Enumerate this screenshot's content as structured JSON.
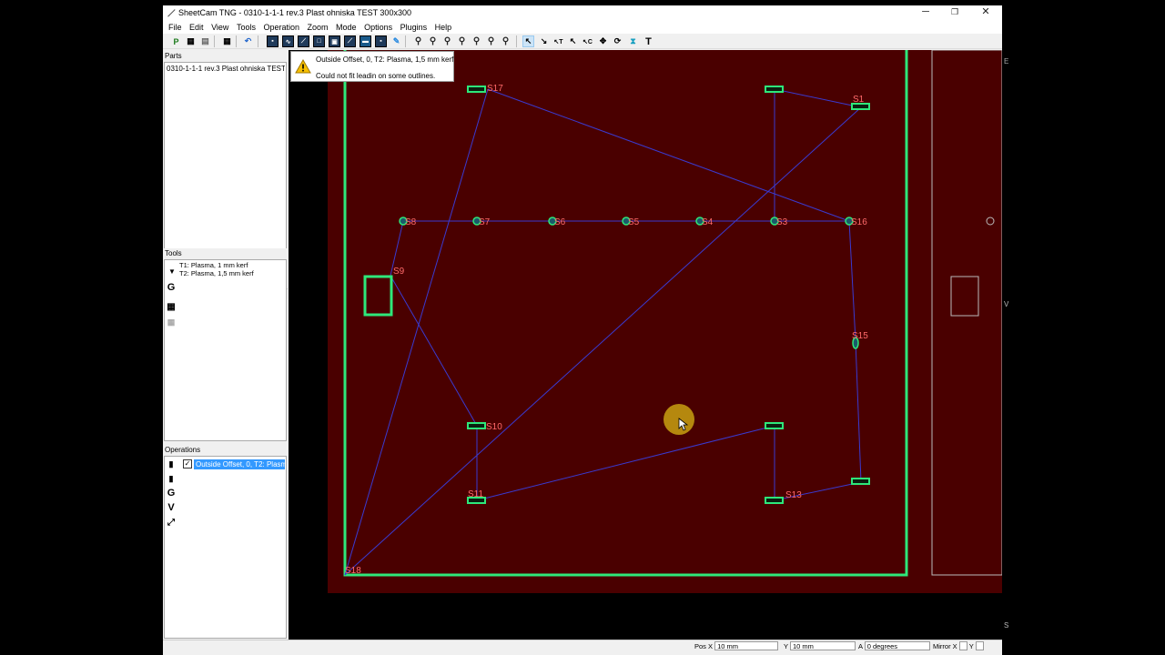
{
  "window": {
    "title": "SheetCam TNG - 0310-1-1-1 rev.3 Plast ohniska TEST 300x300",
    "minimize": "─",
    "maximize": "❐",
    "close": "✕"
  },
  "menu": [
    "File",
    "Edit",
    "View",
    "Tools",
    "Operation",
    "Zoom",
    "Mode",
    "Options",
    "Plugins",
    "Help"
  ],
  "panels": {
    "parts": {
      "title": "Parts",
      "item": "0310-1-1-1 rev.3 Plast ohniska TEST 300x300"
    },
    "tools": {
      "title": "Tools",
      "items": [
        "T1: Plasma, 1 mm kerf",
        "T2: Plasma, 1,5 mm kerf"
      ]
    },
    "operations": {
      "title": "Operations",
      "item": "Outside Offset, 0, T2: Plasma, 1,5 mm kerf",
      "checked": "✓"
    }
  },
  "tooltip": {
    "line1": "Outside Offset, 0, T2: Plasma, 1,5 mm kerf",
    "line2": "Could not fit leadin on some outlines."
  },
  "status": {
    "pos_x_label": "Pos X",
    "pos_x_value": "10 mm",
    "y_label": "Y",
    "y_value": "10 mm",
    "a_label": "A",
    "a_value": "0 degrees",
    "mirror_label": "Mirror X",
    "mirror_y_label": "Y"
  },
  "canvas": {
    "labels": [
      "S1",
      "S3",
      "S4",
      "S5",
      "S6",
      "S7",
      "S8",
      "S9",
      "S10",
      "S11",
      "S13",
      "S15",
      "S16",
      "S17",
      "S18"
    ],
    "right_edge_texts": [
      "E",
      "V",
      "S"
    ],
    "colors": {
      "background": "#4a0000",
      "outline": "#2ee87a",
      "path": "#3a3ad0",
      "label": "#ff6a6a"
    }
  }
}
